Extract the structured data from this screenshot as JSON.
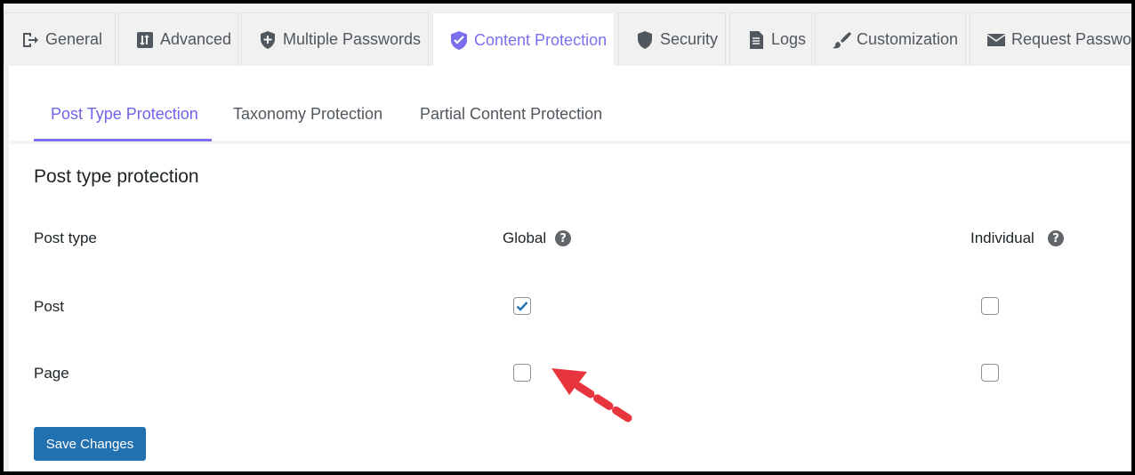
{
  "tabs": [
    {
      "label": "General",
      "icon": "exit-icon"
    },
    {
      "label": "Advanced",
      "icon": "sort-icon"
    },
    {
      "label": "Multiple Passwords",
      "icon": "shield-plus-icon"
    },
    {
      "label": "Content Protection",
      "icon": "shield-check-icon",
      "active": true
    },
    {
      "label": "Security",
      "icon": "shield-icon"
    },
    {
      "label": "Logs",
      "icon": "document-icon"
    },
    {
      "label": "Customization",
      "icon": "brush-icon"
    },
    {
      "label": "Request Password",
      "icon": "envelope-icon"
    }
  ],
  "subtabs": [
    {
      "label": "Post Type Protection",
      "active": true
    },
    {
      "label": "Taxonomy Protection"
    },
    {
      "label": "Partial Content Protection"
    }
  ],
  "section_title": "Post type protection",
  "table": {
    "headers": {
      "post_type": "Post type",
      "global": "Global",
      "individual": "Individual"
    },
    "help_glyph": "?",
    "rows": [
      {
        "label": "Post",
        "global": true,
        "individual": false
      },
      {
        "label": "Page",
        "global": false,
        "individual": false
      }
    ]
  },
  "save_label": "Save Changes",
  "colors": {
    "accent": "#7b6ff0",
    "button": "#2271b1",
    "annotation_arrow": "#e8343c"
  }
}
